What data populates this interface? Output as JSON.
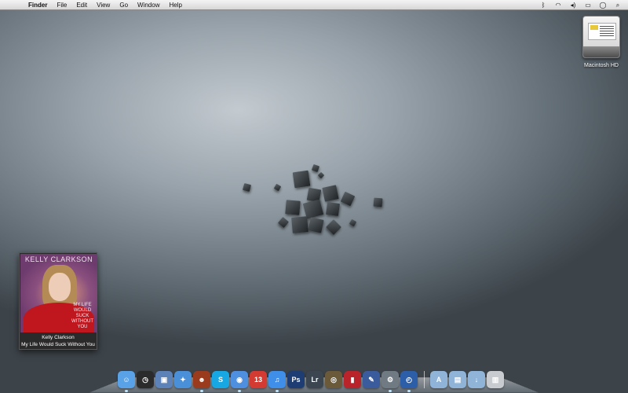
{
  "menubar": {
    "apple_glyph": "",
    "items": [
      "Finder",
      "File",
      "Edit",
      "View",
      "Go",
      "Window",
      "Help"
    ],
    "status_icons": [
      "bluetooth-icon",
      "wifi-icon",
      "volume-icon",
      "battery-icon",
      "clock-icon",
      "spotlight-icon"
    ],
    "status_glyphs": [
      "ᛒ",
      "◠",
      "◂)",
      "▭",
      "◯",
      "⌕"
    ]
  },
  "desktop": {
    "hd_label": "Macintosh HD"
  },
  "itunes_widget": {
    "album_artist_text": "KELLY CLARKSON",
    "cover_song_text": "MY LIFE WOULD SUCK WITHOUT YOU",
    "artist": "Kelly Clarkson",
    "song": "My Life Would Suck Without You"
  },
  "dock": {
    "items": [
      {
        "name": "finder-icon",
        "glyph": "☺",
        "color": "#5aa2e8"
      },
      {
        "name": "dashboard-icon",
        "glyph": "◷",
        "color": "#2b2b2b"
      },
      {
        "name": "preview-icon",
        "glyph": "▣",
        "color": "#5c82b8"
      },
      {
        "name": "safari-icon",
        "glyph": "✦",
        "color": "#4a90d9"
      },
      {
        "name": "mascot-app-icon",
        "glyph": "☻",
        "color": "#9a3b1e"
      },
      {
        "name": "skype-icon",
        "glyph": "S",
        "color": "#17a8e3"
      },
      {
        "name": "ichat-icon",
        "glyph": "◉",
        "color": "#4f8fe0"
      },
      {
        "name": "ical-icon",
        "glyph": "13",
        "color": "#d33b32"
      },
      {
        "name": "itunes-icon",
        "glyph": "♫",
        "color": "#3f8ee8"
      },
      {
        "name": "photoshop-icon",
        "glyph": "Ps",
        "color": "#1e3d73"
      },
      {
        "name": "lightroom-icon",
        "glyph": "Lr",
        "color": "#3c4650"
      },
      {
        "name": "aperture-icon",
        "glyph": "◎",
        "color": "#6a5a3a"
      },
      {
        "name": "photobooth-icon",
        "glyph": "▮",
        "color": "#b8242a"
      },
      {
        "name": "xcode-icon",
        "glyph": "✎",
        "color": "#3a5b9c"
      },
      {
        "name": "system-preferences-icon",
        "glyph": "⚙",
        "color": "#707a82"
      },
      {
        "name": "time-machine-icon",
        "glyph": "◴",
        "color": "#2d5fa8"
      },
      {
        "name": "applications-folder-icon",
        "glyph": "A",
        "color": "#8fb4d8"
      },
      {
        "name": "documents-folder-icon",
        "glyph": "▤",
        "color": "#8fb4d8"
      },
      {
        "name": "downloads-folder-icon",
        "glyph": "↓",
        "color": "#8fb4d8"
      },
      {
        "name": "trash-icon",
        "glyph": "▥",
        "color": "#c8ccd0"
      }
    ],
    "running": [
      0,
      4,
      6,
      8,
      14,
      15
    ]
  }
}
